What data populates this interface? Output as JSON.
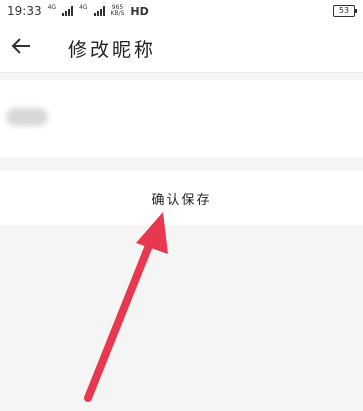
{
  "status_bar": {
    "time": "19:33",
    "network_1": "4G",
    "network_2": "4G",
    "speed_value": "965",
    "speed_unit": "KB/S",
    "hd": "HD",
    "battery": "53"
  },
  "header": {
    "title": "修改昵称"
  },
  "form": {
    "nickname_value": ""
  },
  "confirm": {
    "label": "确认保存"
  },
  "colors": {
    "arrow": "#e8384f",
    "background": "#f5f5f5",
    "card": "#ffffff"
  }
}
